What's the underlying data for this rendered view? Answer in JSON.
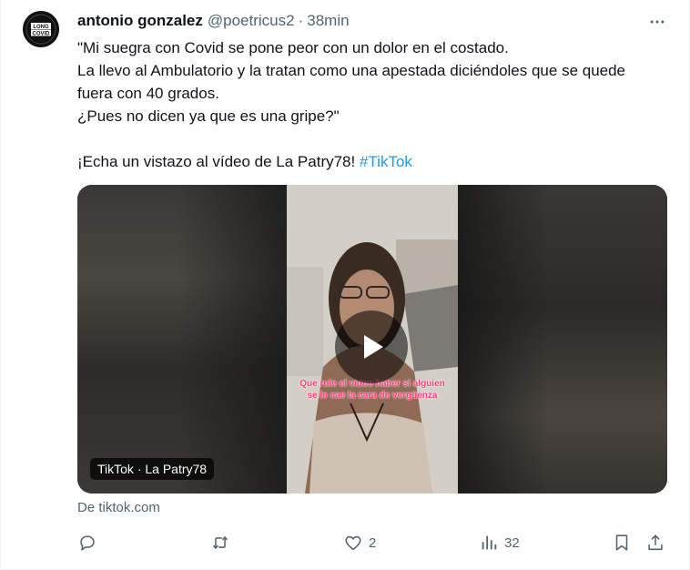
{
  "author": {
    "name": "antonio gonzalez",
    "handle": "@poetricus2",
    "separator": "·",
    "time": "38min",
    "avatar_text": [
      "LONG",
      "COVID"
    ]
  },
  "tweet": {
    "lines": [
      "\"Mi suegra con Covid se pone peor con un dolor en el costado.",
      "La llevo al Ambulatorio y la tratan como una apestada diciéndoles que se quede fuera con 40 grados.",
      "¿Pues no dicen ya que es una gripe?\"",
      "",
      "¡Echa un vistazo al vídeo de La Patry78! "
    ],
    "hashtag": "#TikTok"
  },
  "media": {
    "overlay_caption": "Que rule el video haber si alguien se le cae la cara de vergüenza",
    "source_label": "TikTok · La Patry78",
    "play_icon": "play-icon"
  },
  "link_source": "De tiktok.com",
  "actions": {
    "reply": {
      "icon": "reply-icon",
      "count": ""
    },
    "retweet": {
      "icon": "retweet-icon",
      "count": ""
    },
    "like": {
      "icon": "heart-icon",
      "count": "2"
    },
    "views": {
      "icon": "views-icon",
      "count": "32"
    },
    "bookmark": {
      "icon": "bookmark-icon"
    },
    "share": {
      "icon": "share-icon"
    }
  },
  "colors": {
    "text": "#0f1419",
    "secondary": "#536471",
    "link": "#1d9bf0",
    "overlay_caption": "#ff3b7a"
  }
}
